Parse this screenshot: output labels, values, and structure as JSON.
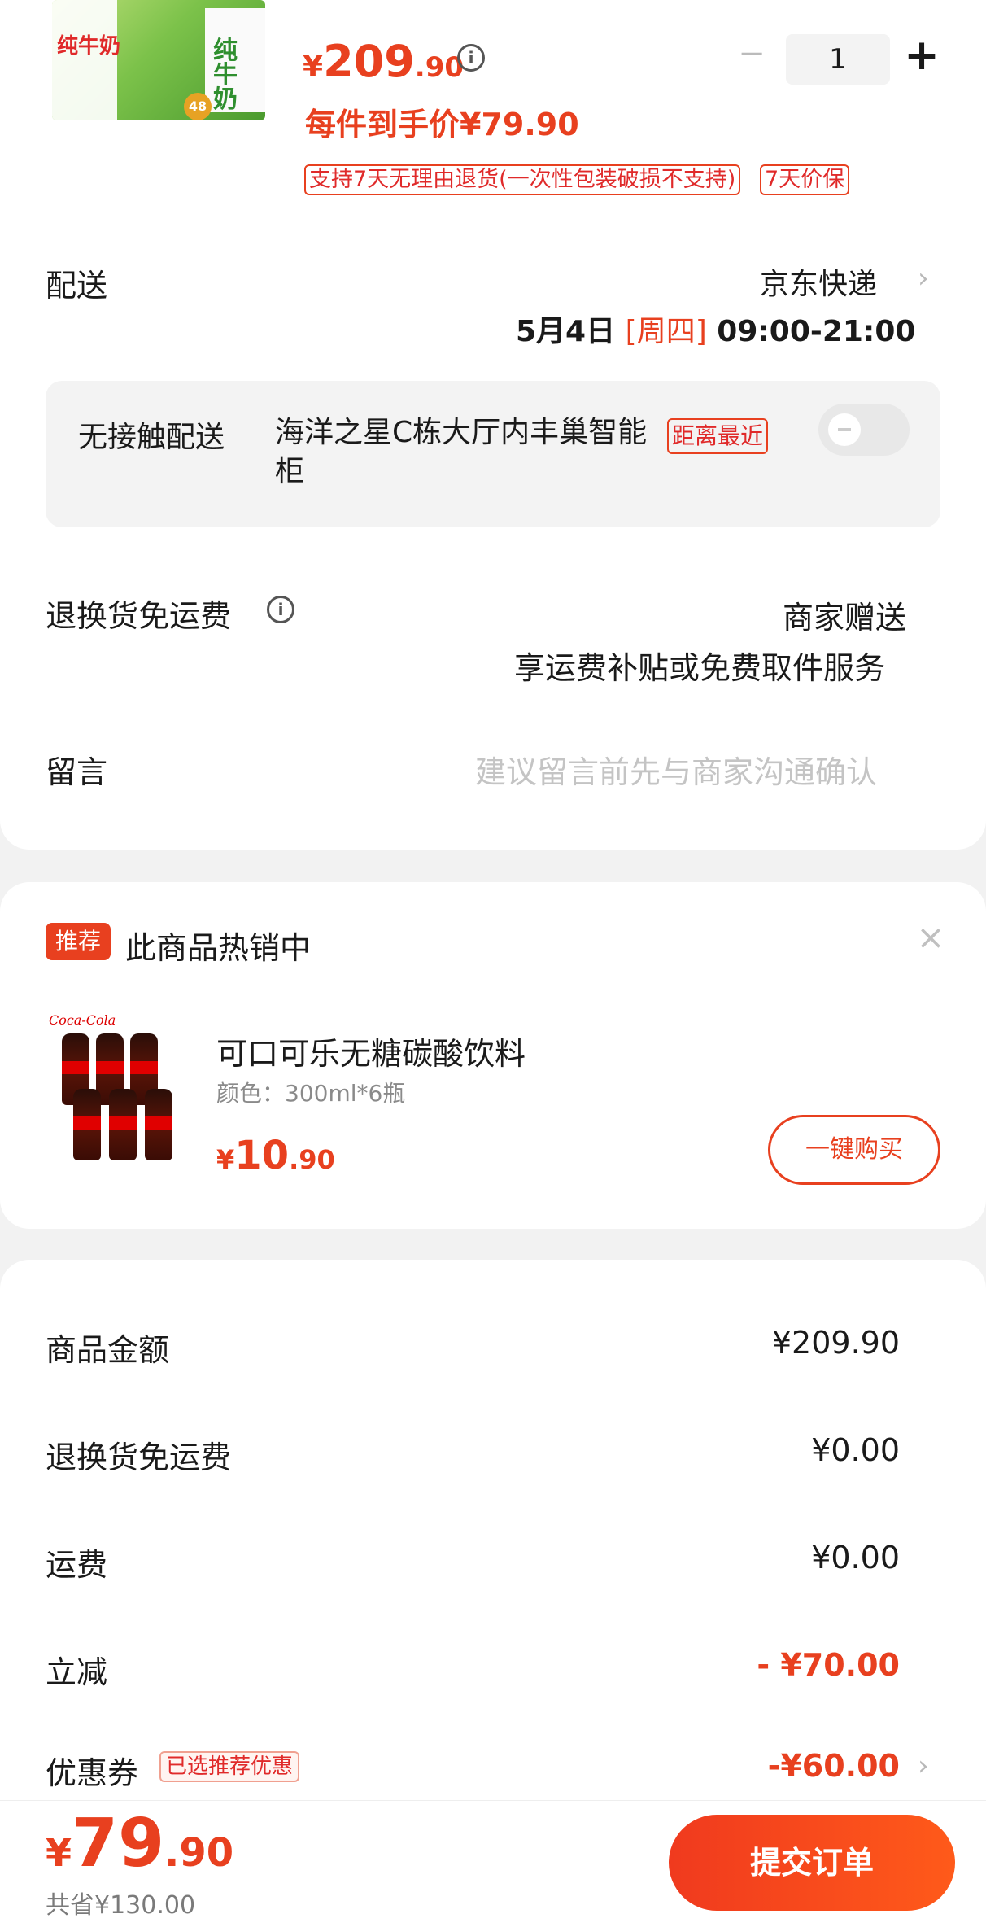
{
  "product": {
    "thumb_text": "纯牛奶",
    "thumb_text_2": "纯牛奶",
    "thumb_badge": "48",
    "price_symbol": "¥",
    "price_int": "209",
    "price_dec": ".90",
    "qty": "1",
    "minus": "−",
    "plus": "+",
    "hand_price": "每件到手价¥79.90",
    "tag_return": "支持7天无理由退货(一次性包装破损不支持)",
    "tag_protect": "7天价保"
  },
  "delivery": {
    "label": "配送",
    "carrier": "京东快递",
    "date": "5月4日",
    "weekday": "[周四]",
    "time": "09:00-21:00",
    "contactless_label": "无接触配送",
    "location": "海洋之星C栋大厅内丰巢智能柜",
    "nearest_tag": "距离最近"
  },
  "return_ship": {
    "label": "退换货免运费",
    "value": "商家赠送",
    "desc": "享运费补贴或免费取件服务"
  },
  "message": {
    "label": "留言",
    "placeholder": "建议留言前先与商家沟通确认"
  },
  "recommend": {
    "badge": "推荐",
    "title": "此商品热销中",
    "close": "×",
    "logo_text": "Coca-Cola",
    "item_name": "可口可乐无糖碳酸饮料",
    "item_spec": "颜色：300ml*6瓶",
    "price_symbol": "¥",
    "price_int": "10",
    "price_dec": ".90",
    "buy_label": "一键购买"
  },
  "summary": {
    "rows": [
      {
        "label": "商品金额",
        "value": "¥209.90"
      },
      {
        "label": "退换货免运费",
        "value": "¥0.00"
      },
      {
        "label": "运费",
        "value": "¥0.00"
      },
      {
        "label": "立减",
        "value": "- ¥70.00"
      },
      {
        "label": "优惠券",
        "value": "-¥60.00",
        "tag": "已选推荐优惠"
      }
    ]
  },
  "footer": {
    "total_symbol": "¥",
    "total_int": "79",
    "total_dec": ".90",
    "saved": "共省¥130.00",
    "submit_label": "提交订单"
  },
  "colors": {
    "accent": "#e8401f",
    "background": "#f2f2f2"
  }
}
